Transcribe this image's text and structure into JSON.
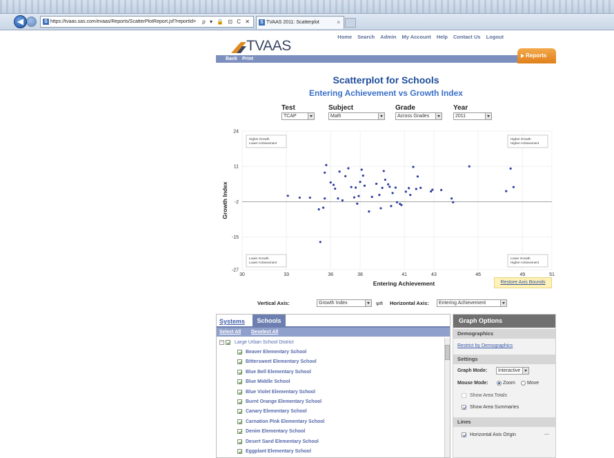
{
  "browser": {
    "url": "https://tvaas.sas.com/evaas/Reports/ScatterPlotReport.jsf?reportId=",
    "url_icons": "ρ ▾ 🔒 ⊡ C ✕",
    "tab_title": "TVAAS 2011: Scatterplot",
    "tab_favicon": "S",
    "url_favicon": "S",
    "tab_close": "×"
  },
  "header": {
    "logo": "TVAAS",
    "nav": [
      "Home",
      "Search",
      "Admin",
      "My Account",
      "Help",
      "Contact Us",
      "Logout"
    ],
    "reports": "Reports",
    "subnav": {
      "back": "Back",
      "print": "Print"
    }
  },
  "page": {
    "title": "Scatterplot for Schools",
    "subtitle": "Entering Achievement vs Growth Index"
  },
  "filters": {
    "test": {
      "label": "Test",
      "value": "TCAP"
    },
    "subject": {
      "label": "Subject",
      "value": "Math"
    },
    "grade": {
      "label": "Grade",
      "value": "Across Grades"
    },
    "year": {
      "label": "Year",
      "value": "2011"
    }
  },
  "chart_data": {
    "type": "scatter",
    "xlabel": "Entering Achievement",
    "ylabel": "Growth Index",
    "xlim": [
      30,
      51
    ],
    "ylim": [
      -27,
      24
    ],
    "xticks": [
      30,
      33,
      36,
      38,
      41,
      43,
      46,
      49,
      51
    ],
    "yticks": [
      24,
      11,
      -2,
      -15,
      -27
    ],
    "reference_line_y": -2,
    "quadrant_labels": {
      "top_left": [
        "Higher Growth",
        "Lower Achievement"
      ],
      "top_right": [
        "Higher Growth",
        "Higher Achievement"
      ],
      "bottom_left": [
        "Lower Growth",
        "Lower Achievement"
      ],
      "bottom_right": [
        "Lower Growth",
        "Higher Achievement"
      ]
    },
    "points": [
      [
        33.1,
        0.2
      ],
      [
        33.9,
        -0.5
      ],
      [
        34.6,
        -0.5
      ],
      [
        35.2,
        -4.8
      ],
      [
        35.3,
        -16.8
      ],
      [
        35.5,
        -4.2
      ],
      [
        35.6,
        -0.8
      ],
      [
        35.6,
        8.7
      ],
      [
        35.7,
        11.5
      ],
      [
        36.0,
        5.1
      ],
      [
        36.2,
        4.2
      ],
      [
        36.3,
        2.8
      ],
      [
        36.5,
        -0.8
      ],
      [
        36.6,
        9.1
      ],
      [
        36.8,
        -1.5
      ],
      [
        37.0,
        7.4
      ],
      [
        37.2,
        10.3
      ],
      [
        37.4,
        3.4
      ],
      [
        37.6,
        -0.4
      ],
      [
        37.7,
        3.2
      ],
      [
        37.8,
        -2.7
      ],
      [
        37.9,
        0.1
      ],
      [
        38.0,
        5.3
      ],
      [
        38.1,
        9.8
      ],
      [
        38.2,
        7.6
      ],
      [
        38.3,
        3.9
      ],
      [
        38.6,
        -5.6
      ],
      [
        38.8,
        -0.2
      ],
      [
        39.1,
        4.6
      ],
      [
        39.3,
        0.5
      ],
      [
        39.4,
        -4.4
      ],
      [
        39.5,
        3.1
      ],
      [
        39.6,
        9.3
      ],
      [
        39.7,
        6.1
      ],
      [
        39.9,
        4.4
      ],
      [
        40.0,
        3.5
      ],
      [
        40.1,
        -3.6
      ],
      [
        40.2,
        1.2
      ],
      [
        40.4,
        3.2
      ],
      [
        40.5,
        -2.2
      ],
      [
        40.7,
        -2.8
      ],
      [
        40.8,
        -3.2
      ],
      [
        41.1,
        1.7
      ],
      [
        41.3,
        3.0
      ],
      [
        41.4,
        0.5
      ],
      [
        41.6,
        10.8
      ],
      [
        41.8,
        2.7
      ],
      [
        41.9,
        7.3
      ],
      [
        42.1,
        3.1
      ],
      [
        42.8,
        1.8
      ],
      [
        42.9,
        2.4
      ],
      [
        43.5,
        2.3
      ],
      [
        44.2,
        -0.8
      ],
      [
        44.3,
        -2.2
      ],
      [
        45.4,
        11.0
      ],
      [
        47.9,
        1.9
      ],
      [
        48.2,
        10.2
      ],
      [
        48.4,
        3.4
      ]
    ]
  },
  "axes_controls": {
    "vertical_label": "Vertical Axis:",
    "vertical_value": "Growth Index",
    "horizontal_label": "Horizontal Axis:",
    "horizontal_value": "Entering Achievement",
    "restore": "Restore Axis Bounds"
  },
  "left_panel": {
    "tabs": [
      "Systems",
      "Schools"
    ],
    "select_all": "Select All",
    "deselect_all": "Deselect All",
    "district": "Large Urban School District",
    "schools": [
      "Beaver Elementary School",
      "Bittersweet Elementary School",
      "Blue Bell Elementary School",
      "Blue Middle School",
      "Blue Violet Elementary School",
      "Burnt Orange Elementary School",
      "Canary Elementary School",
      "Carnation Pink Elementary School",
      "Denim Elementary School",
      "Desert Sand Elementary School",
      "Eggplant Elementary School"
    ]
  },
  "graph_options": {
    "title": "Graph Options",
    "demographics": "Demographics",
    "restrict_link": "Restrict by Demographics",
    "settings": "Settings",
    "graph_mode_label": "Graph Mode:",
    "graph_mode_value": "Interactive",
    "mouse_mode_label": "Mouse Mode:",
    "zoom": "Zoom",
    "move": "Move",
    "show_area_totals": "Show Area Totals",
    "show_area_summaries": "Show Area Summaries",
    "lines": "Lines",
    "horizontal_axis_origin": "Horizontal Axis Origin",
    "line_swatch": "—"
  },
  "colors": {
    "title_blue": "#1e4c9a",
    "point_blue": "#2e3fa0",
    "reports_orange": "#e8902c",
    "subbar": "#7c8fbe"
  }
}
